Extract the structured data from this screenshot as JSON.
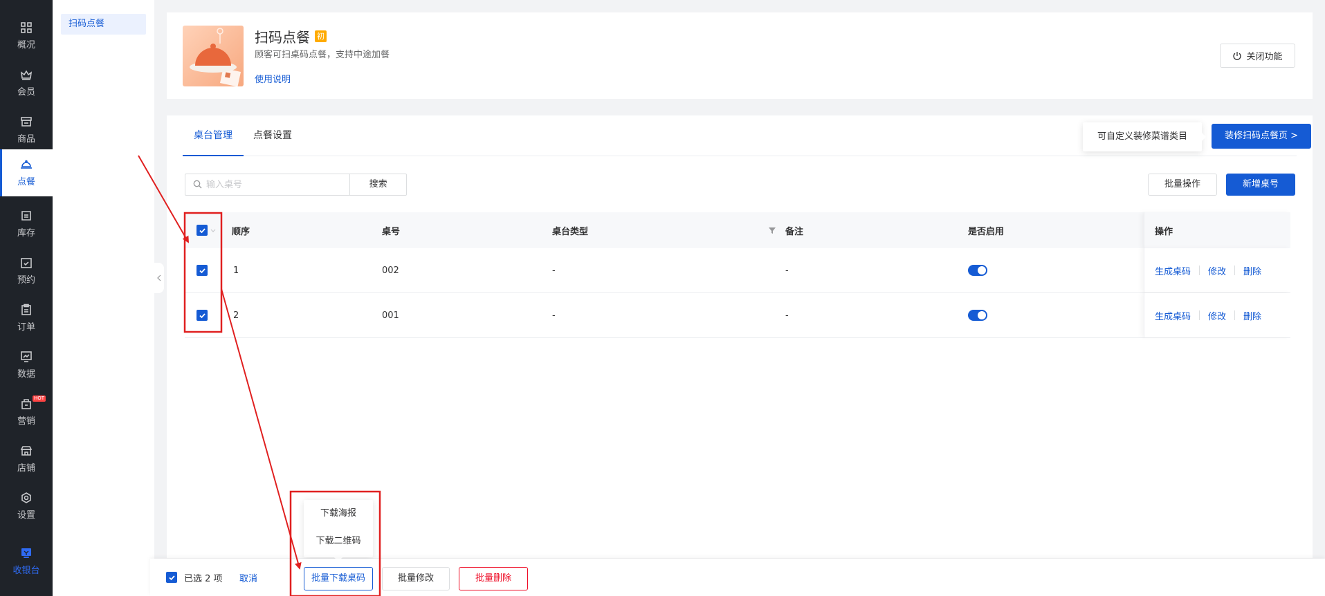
{
  "nav": {
    "items": [
      {
        "label": "概况",
        "icon": "grid-icon"
      },
      {
        "label": "会员",
        "icon": "crown-icon"
      },
      {
        "label": "商品",
        "icon": "store-icon"
      },
      {
        "label": "点餐",
        "icon": "dish-cover-icon",
        "active": true
      },
      {
        "label": "库存",
        "icon": "inventory-icon"
      },
      {
        "label": "预约",
        "icon": "calendar-check-icon"
      },
      {
        "label": "订单",
        "icon": "clipboard-icon"
      },
      {
        "label": "数据",
        "icon": "chart-icon"
      },
      {
        "label": "营销",
        "icon": "marketing-icon",
        "badge": "HOT"
      },
      {
        "label": "店铺",
        "icon": "shop-icon"
      },
      {
        "label": "设置",
        "icon": "gear-icon"
      }
    ],
    "cashier": {
      "label": "收银台",
      "icon": "cashier-icon"
    }
  },
  "subnav": {
    "active_item": "扫码点餐"
  },
  "app": {
    "title": "扫码点餐",
    "badge": "初",
    "desc": "顾客可扫桌码点餐，支持中途加餐",
    "help_link": "使用说明",
    "close_button": "关闭功能"
  },
  "tabs": [
    {
      "label": "桌台管理",
      "active": true
    },
    {
      "label": "点餐设置",
      "active": false
    }
  ],
  "tip": "可自定义装修菜谱类目",
  "decorate_button": "装修扫码点餐页 >",
  "search": {
    "placeholder": "输入桌号",
    "button": "搜索"
  },
  "toolbar": {
    "batch_button": "批量操作",
    "add_button": "新增桌号"
  },
  "table": {
    "headers": {
      "order": "顺序",
      "table_no": "桌号",
      "type": "桌台类型",
      "remark": "备注",
      "enabled": "是否启用",
      "actions": "操作"
    },
    "rows": [
      {
        "order": "1",
        "table_no": "002",
        "type": "-",
        "remark": "-",
        "enabled": true
      },
      {
        "order": "2",
        "table_no": "001",
        "type": "-",
        "remark": "-",
        "enabled": true
      }
    ],
    "actions": {
      "gen": "生成桌码",
      "edit": "修改",
      "delete": "删除"
    }
  },
  "bottom_bar": {
    "selected_text": "已选 2 项",
    "cancel": "取消",
    "download": "批量下载桌码",
    "edit": "批量修改",
    "delete": "批量删除"
  },
  "dropdown": {
    "items": [
      "下载海报",
      "下载二维码"
    ]
  },
  "colors": {
    "primary": "#155bd4",
    "danger": "#ee0a24",
    "nav_bg": "#1f2329",
    "annotation": "#e02020"
  }
}
